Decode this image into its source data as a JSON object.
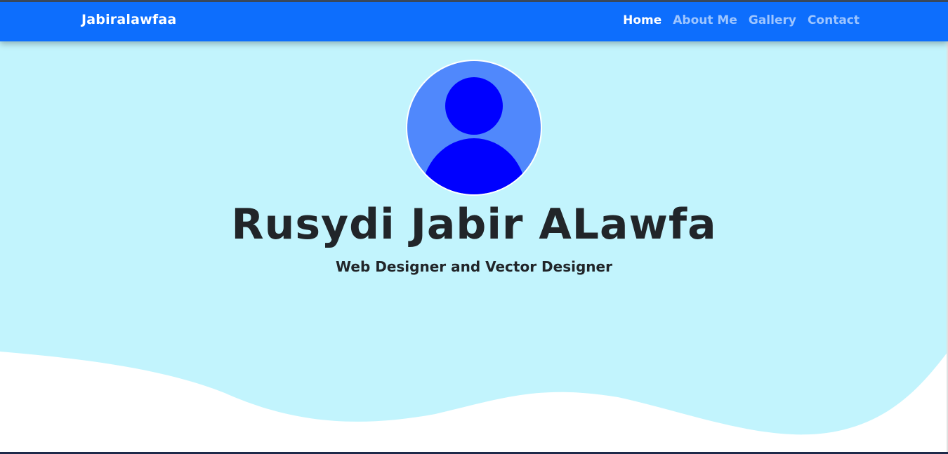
{
  "navbar": {
    "brand": "Jabiralawfaa",
    "links": [
      {
        "label": "Home",
        "active": true
      },
      {
        "label": "About Me",
        "active": false
      },
      {
        "label": "Gallery",
        "active": false
      },
      {
        "label": "Contact",
        "active": false
      }
    ]
  },
  "hero": {
    "avatar_icon": "user-avatar-icon",
    "name": "Rusydi Jabir ALawfa",
    "tagline": "Web Designer and Vector Designer"
  },
  "colors": {
    "navbar": "#0d6efd",
    "hero_bg": "#c2f4fd",
    "avatar_bg": "#5088fc",
    "avatar_figure": "#0000ff",
    "wave": "#ffffff"
  }
}
